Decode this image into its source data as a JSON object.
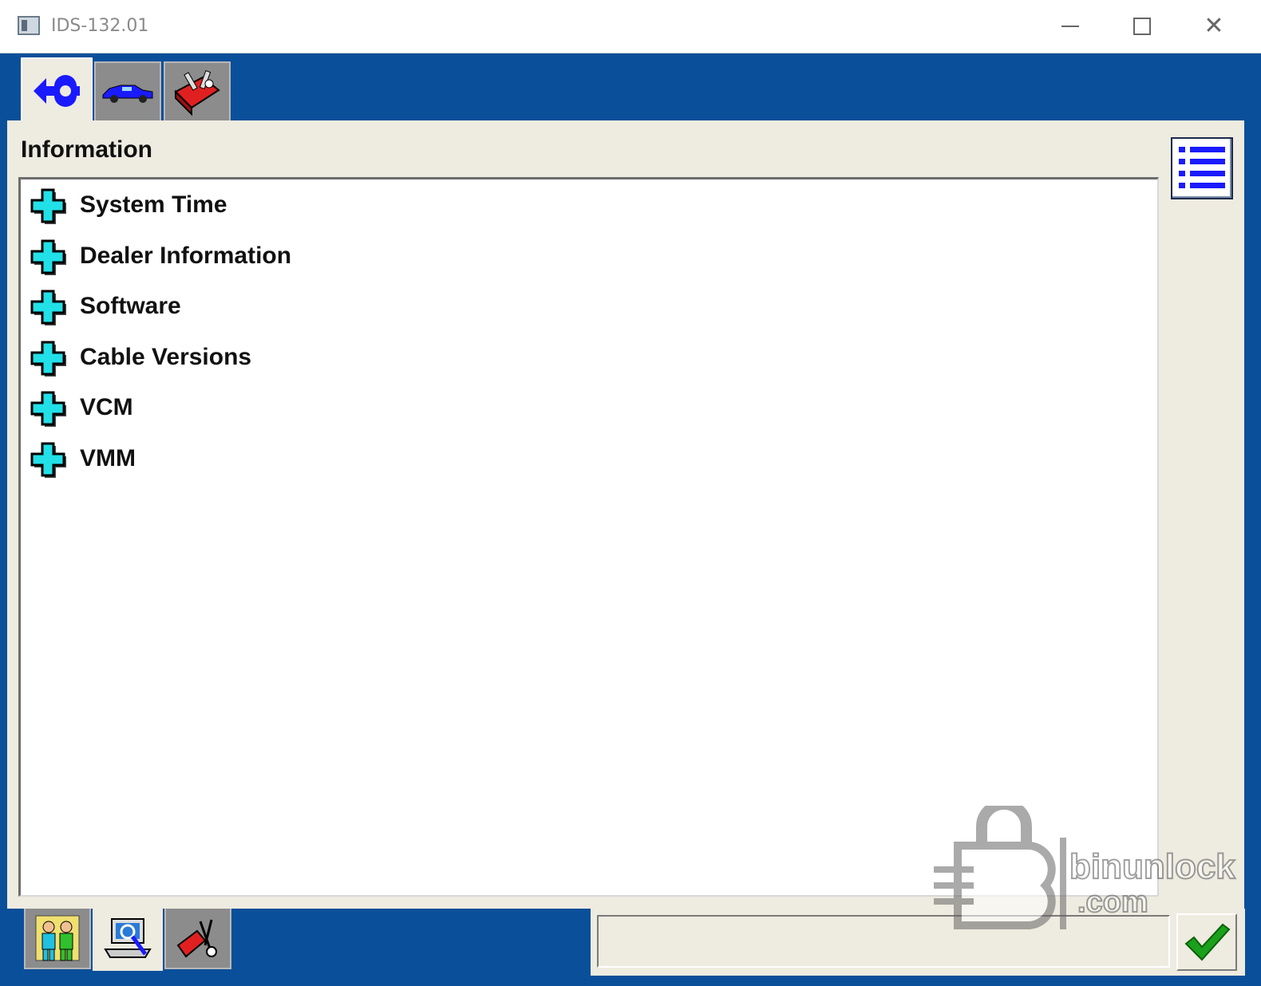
{
  "window": {
    "title": "IDS-132.01",
    "minimize_icon": "minimize-icon",
    "maximize_icon": "maximize-icon",
    "close_icon": "close-icon"
  },
  "top_tabs": [
    {
      "icon": "connect-arrow-icon",
      "active": true
    },
    {
      "icon": "vehicle-car-icon",
      "active": false
    },
    {
      "icon": "toolbox-icon",
      "active": false
    }
  ],
  "panel": {
    "title": "Information",
    "list_view_icon": "list-view-icon"
  },
  "tree": {
    "items": [
      {
        "label": "System Time"
      },
      {
        "label": "Dealer Information"
      },
      {
        "label": "Software"
      },
      {
        "label": "Cable Versions"
      },
      {
        "label": "VCM"
      },
      {
        "label": "VMM"
      }
    ],
    "expand_icon": "plus-expand-icon",
    "expand_color": "#22e0e8"
  },
  "bottom_tabs": [
    {
      "icon": "users-icon",
      "active": false
    },
    {
      "icon": "computer-search-icon",
      "active": true
    },
    {
      "icon": "tools-icon",
      "active": false
    }
  ],
  "status": {
    "text": "",
    "confirm_icon": "checkmark-icon"
  },
  "watermark": {
    "line1": "binunlock",
    "line2": ".com"
  },
  "colors": {
    "frame_blue": "#0a4f9a",
    "panel_bg": "#eeebe0",
    "tab_inactive": "#8c8c8c",
    "accent_blue": "#1a1aff",
    "check_green": "#1aa01a"
  }
}
